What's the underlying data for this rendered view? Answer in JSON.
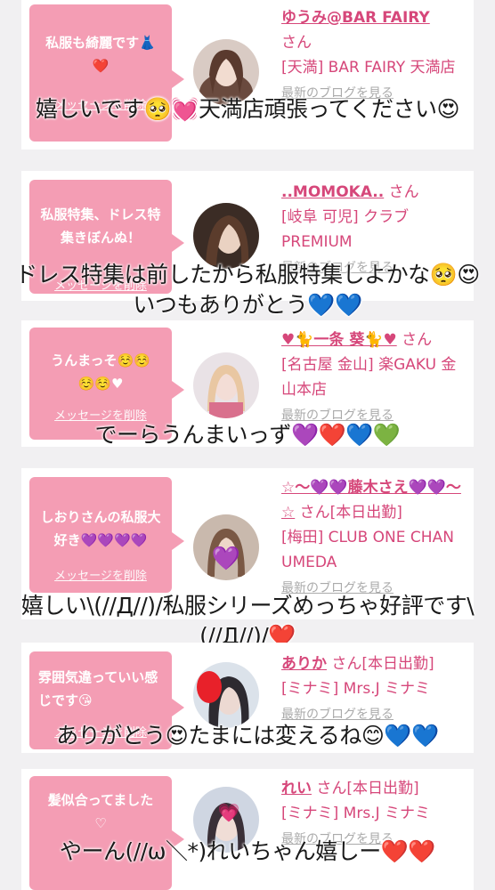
{
  "colors": {
    "accent": "#d6477a",
    "bubble": "#f49db4",
    "background": "#f1f0f2"
  },
  "common": {
    "delete_label": "メッセージを削除",
    "blog_label": "最新のブログを見る",
    "san": "さん"
  },
  "items": [
    {
      "message": "私服も綺麗です👗\n❤️",
      "name": "ゆうみ@BAR FAIRY",
      "shop": "[天満] BAR FAIRY 天満店",
      "reply": "嬉しいです🥺💓天満店頑張ってください😍"
    },
    {
      "message": "私服特集、ドレス特集きぼんぬ！",
      "name": "..MOMOKA..",
      "shop": "[岐阜 可児] クラブ PREMIUM",
      "reply": "ドレス特集は前したから私服特集しよかな🥺😍いつもありがとう💙💙"
    },
    {
      "message": "うんまっそ☺️☺️\n☺️☺️♥",
      "name": "♥🐈一条 葵🐈♥",
      "shop": "[名古屋 金山] 楽GAKU 金山本店",
      "reply": "でーらうんまいっず💜❤️💙💚"
    },
    {
      "message": "しおりさんの私服大好き💜💜💜💜",
      "name": "☆〜💜💜藤木さえ💜💜〜☆",
      "status": "[本日出勤]",
      "shop": "[梅田] CLUB ONE CHAN UMEDA",
      "reply": "嬉しい\\(//Д//)/私服シリーズめっちゃ好評です\\(//Д//)/❤️"
    },
    {
      "message": "雰囲気違っていい感じです😘",
      "name": "ありか",
      "status": "[本日出勤]",
      "shop": "[ミナミ] Mrs.J ミナミ",
      "reply": "ありがとう😍たまには変えるね😊💙💙"
    },
    {
      "message": "髪似合ってました\n♡",
      "name": "れい",
      "status": "[本日出勤]",
      "shop": "[ミナミ] Mrs.J ミナミ",
      "reply": "やーん(//ω＼*)れいちゃん嬉しー❤️❤️"
    }
  ]
}
